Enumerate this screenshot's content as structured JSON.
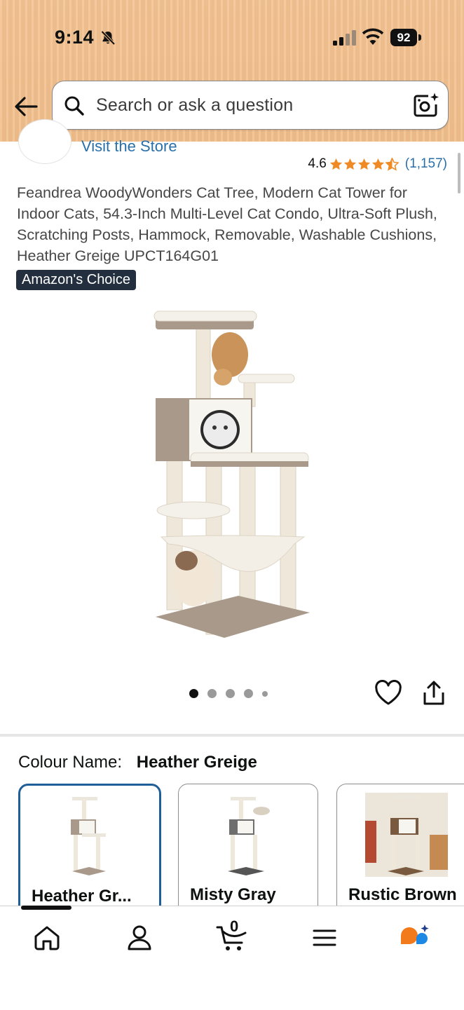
{
  "status_bar": {
    "time": "9:14",
    "battery": "92",
    "icons": [
      "bell-slash-icon",
      "signal-icon",
      "wifi-icon",
      "battery-icon"
    ]
  },
  "search": {
    "placeholder": "Search or ask a question",
    "back_icon": "arrow-left-icon",
    "search_icon": "magnifier-icon",
    "camera_icon": "camera-sparkle-icon"
  },
  "product": {
    "store_link": "Visit the Store",
    "rating_value": "4.6",
    "rating_stars": 4.5,
    "rating_count": "(1,157)",
    "title": "Feandrea WoodyWonders Cat Tree, Modern Cat Tower for Indoor Cats, 54.3-Inch Multi-Level Cat Condo, Ultra-Soft Plush, Scratching Posts, Hammock, Removable, Washable Cushions, Heather Greige UPCT164G01",
    "badge": "Amazon's Choice",
    "image_count": 5,
    "active_image": 1
  },
  "colour": {
    "label": "Colour Name:",
    "selected": "Heather Greige",
    "options": [
      {
        "label": "Heather Gr...",
        "selected": true
      },
      {
        "label": "Misty Gray",
        "selected": false
      },
      {
        "label": "Rustic Brown",
        "selected": false
      }
    ]
  },
  "bottom_nav": {
    "items": [
      "home-icon",
      "account-icon",
      "cart-icon",
      "menu-icon",
      "rufus-assistant-icon"
    ],
    "cart_count": "0"
  },
  "colors": {
    "header_bg": "#f2bf8c",
    "link": "#2a6fa8",
    "star": "#f08a24",
    "badge_bg": "#232f3e",
    "selected_border": "#1f5f99"
  }
}
